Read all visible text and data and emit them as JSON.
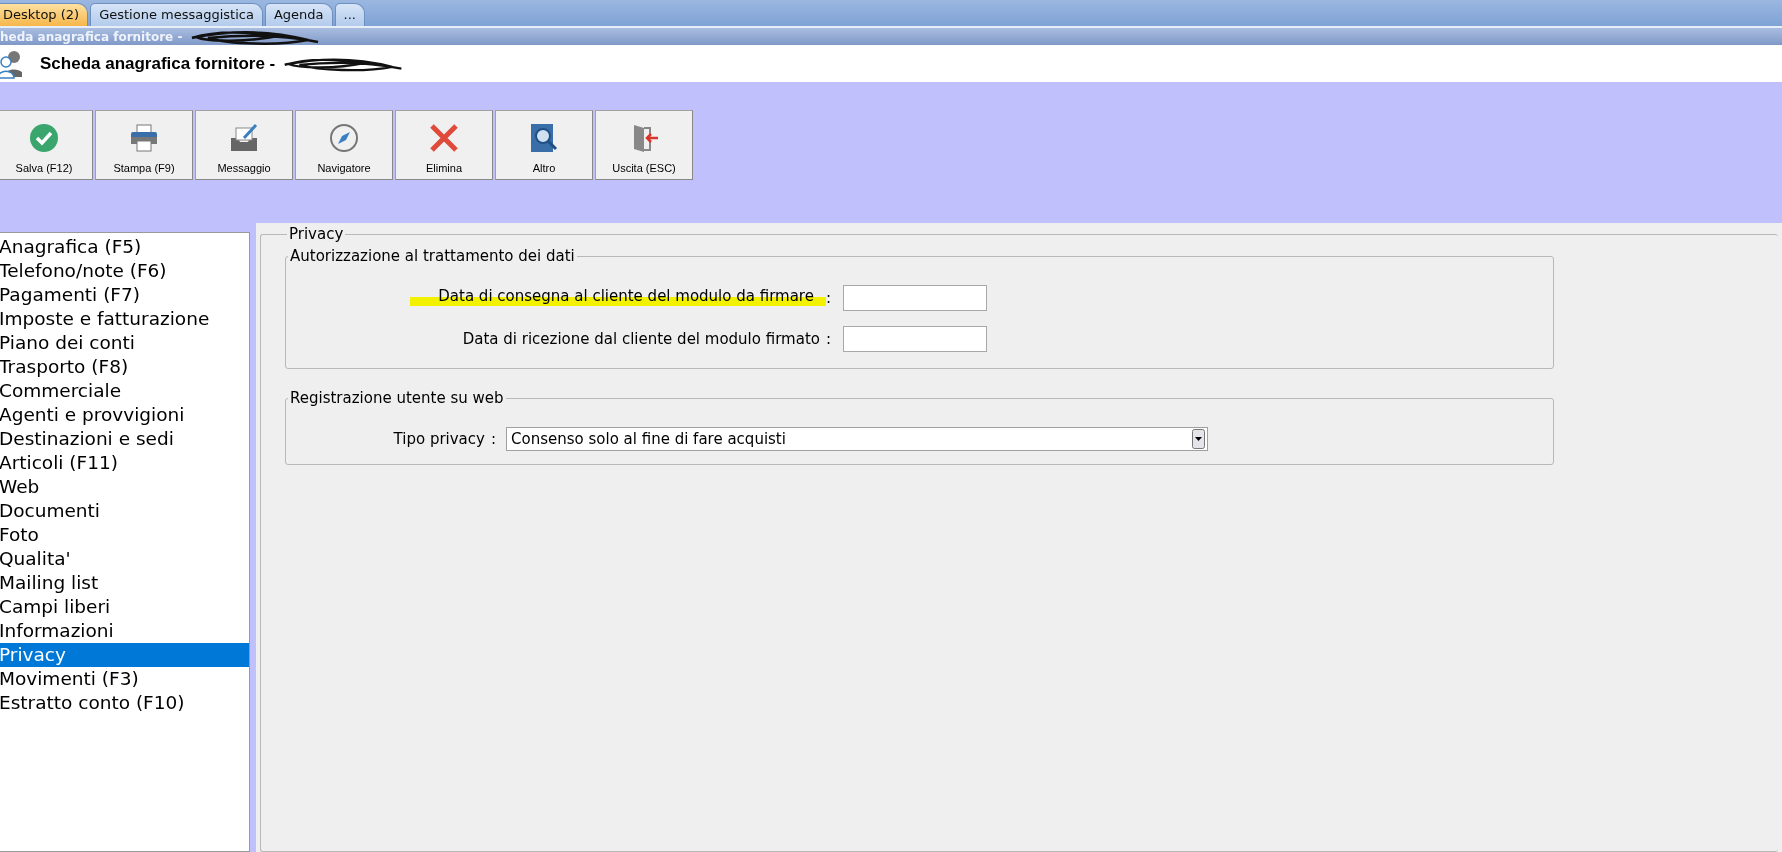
{
  "tabs": [
    {
      "label": "Desktop (2)",
      "selected": true
    },
    {
      "label": "Gestione messaggistica",
      "selected": false
    },
    {
      "label": "Agenda",
      "selected": false
    },
    {
      "label": "...",
      "selected": false
    }
  ],
  "subtitle": "heda anagrafica fornitore -",
  "title": "Scheda anagrafica fornitore -",
  "toolbar": [
    {
      "label": "Salva (F12)",
      "kind": "save"
    },
    {
      "label": "Stampa (F9)",
      "kind": "print"
    },
    {
      "label": "Messaggio",
      "kind": "message"
    },
    {
      "label": "Navigatore",
      "kind": "compass"
    },
    {
      "label": "Elimina",
      "kind": "delete"
    },
    {
      "label": "Altro",
      "kind": "search"
    },
    {
      "label": "Uscita (ESC)",
      "kind": "exit"
    }
  ],
  "sidebar": {
    "items": [
      {
        "label": "Anagrafica (F5)",
        "selected": false
      },
      {
        "label": "Telefono/note (F6)",
        "selected": false
      },
      {
        "label": "Pagamenti (F7)",
        "selected": false
      },
      {
        "label": "Imposte e fatturazione",
        "selected": false
      },
      {
        "label": "Piano dei conti",
        "selected": false
      },
      {
        "label": "Trasporto (F8)",
        "selected": false
      },
      {
        "label": "Commerciale",
        "selected": false
      },
      {
        "label": "Agenti e provvigioni",
        "selected": false
      },
      {
        "label": "Destinazioni e sedi",
        "selected": false
      },
      {
        "label": "Articoli (F11)",
        "selected": false
      },
      {
        "label": "Web",
        "selected": false
      },
      {
        "label": "Documenti",
        "selected": false
      },
      {
        "label": "Foto",
        "selected": false
      },
      {
        "label": "Qualita'",
        "selected": false
      },
      {
        "label": "Mailing list",
        "selected": false
      },
      {
        "label": "Campi liberi",
        "selected": false
      },
      {
        "label": "Informazioni",
        "selected": false
      },
      {
        "label": "Privacy",
        "selected": true
      },
      {
        "label": "Movimenti (F3)",
        "selected": false
      },
      {
        "label": "Estratto conto (F10)",
        "selected": false
      }
    ]
  },
  "panel": {
    "title": "Privacy",
    "groups": [
      {
        "title": "Autorizzazione al trattamento dei dati",
        "fields": [
          {
            "kind": "date",
            "label": "Data di consegna al cliente del modulo da firmare",
            "separator": ":",
            "highlighted": true
          },
          {
            "kind": "date",
            "label": "Data di ricezione dal cliente del modulo firmato",
            "separator": ":",
            "highlighted": false
          }
        ]
      },
      {
        "title": "Registrazione utente su web",
        "fields": [
          {
            "kind": "select",
            "label": "Tipo privacy",
            "separator": ":",
            "value": "Consenso solo al fine di fare acquisti",
            "highlighted": false
          }
        ]
      }
    ]
  }
}
